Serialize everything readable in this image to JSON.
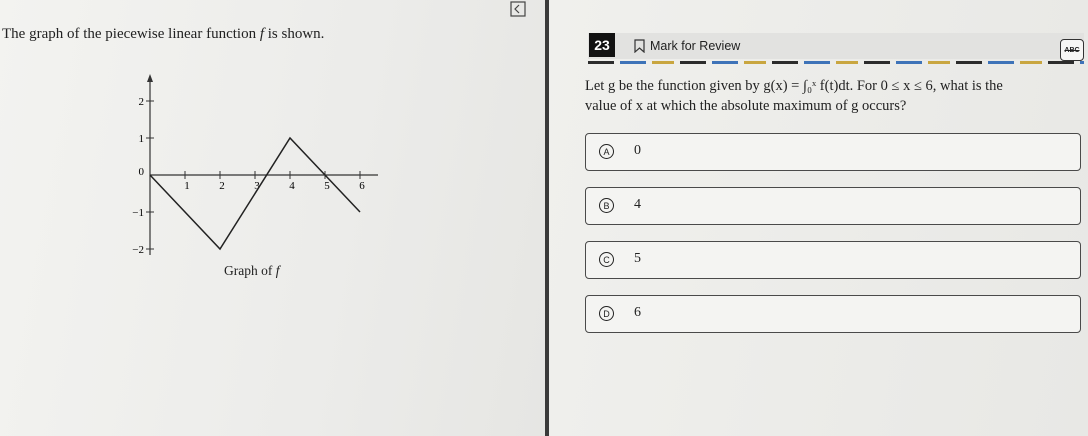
{
  "question": {
    "prompt_prefix": "The graph of the piecewise linear function ",
    "prompt_var": "f",
    "prompt_suffix": " is shown.",
    "graph_caption": "Graph of f",
    "number": "23",
    "mark_for_review": "Mark for Review",
    "abc_label": "ABC",
    "stem_line1": "Let g be the function given by g(x) = ∫₀ˣ f(t)dt. For 0 ≤ x ≤ 6, what is the",
    "stem_line2": "value of x at which the absolute maximum of g occurs?"
  },
  "choices": [
    {
      "letter": "A",
      "value": "0"
    },
    {
      "letter": "B",
      "value": "4"
    },
    {
      "letter": "C",
      "value": "5"
    },
    {
      "letter": "D",
      "value": "6"
    }
  ],
  "graph": {
    "x_ticks": [
      "1",
      "2",
      "3",
      "4",
      "5",
      "6"
    ],
    "y_ticks": [
      "2",
      "1",
      "0",
      "−1",
      "−2"
    ],
    "points": [
      [
        0,
        0
      ],
      [
        2,
        -2
      ],
      [
        4,
        1
      ],
      [
        6,
        -1
      ]
    ]
  },
  "icons": [
    "collapse-pane-icon",
    "expand-pane-icon",
    "bookmark-icon"
  ],
  "colors": {
    "question_number_bg": "#121212",
    "dash_blue": "#3e73b8",
    "dash_gold": "#c9a640"
  }
}
